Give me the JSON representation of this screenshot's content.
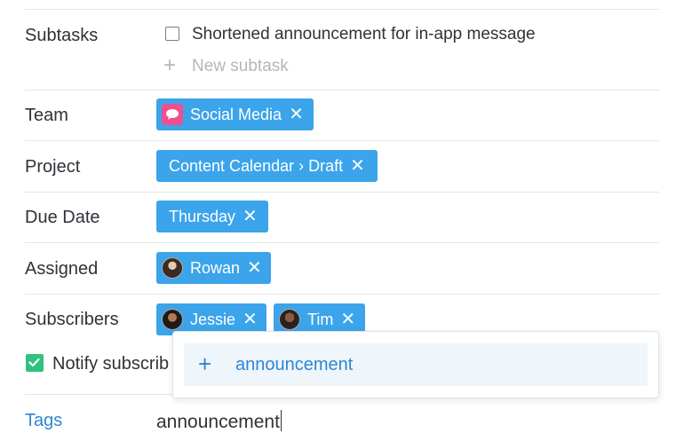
{
  "subtasks": {
    "label": "Subtasks",
    "items": [
      {
        "text": "Shortened announcement for in-app message",
        "checked": false
      }
    ],
    "new_placeholder": "New subtask"
  },
  "team": {
    "label": "Team",
    "chip": "Social Media"
  },
  "project": {
    "label": "Project",
    "chip": "Content Calendar › Draft"
  },
  "due_date": {
    "label": "Due Date",
    "chip": "Thursday"
  },
  "assigned": {
    "label": "Assigned",
    "chip": "Rowan"
  },
  "subscribers": {
    "label": "Subscribers",
    "chips": [
      "Jessie",
      "Tim"
    ]
  },
  "notify": {
    "label": "Notify subscrib",
    "checked": true
  },
  "tags": {
    "label": "Tags",
    "input_value": "announcement"
  },
  "dropdown": {
    "option_label": "announcement"
  },
  "icons": {
    "remove": "close-icon",
    "add": "plus-icon",
    "team": "chat-bubble-icon"
  },
  "colors": {
    "chip": "#3ba4ea",
    "accent": "#2f86d1",
    "check": "#2ec27e",
    "team_icon": "#ef4f8c"
  }
}
